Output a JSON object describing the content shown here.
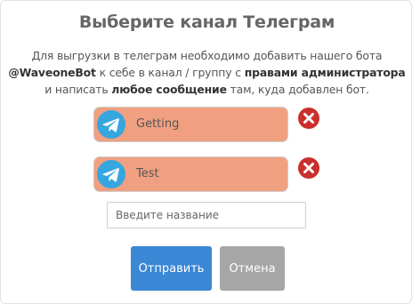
{
  "dialog": {
    "title": "Выберите канал Телеграм",
    "desc": {
      "line1": "Для выгрузки в телеграм необходимо добавить нашего бота",
      "bot": "@WaveoneBot",
      "line2_mid": " к себе в канал / группу с ",
      "rights": "правами администратора",
      "line3_pre": "и написать ",
      "any_message": "любое сообщение",
      "line3_post": " там, куда добавлен бот."
    }
  },
  "channels": [
    {
      "name": "Getting",
      "icon": "telegram-icon",
      "remove_icon": "close-icon"
    },
    {
      "name": "Test",
      "icon": "telegram-icon",
      "remove_icon": "close-icon"
    }
  ],
  "new_channel_input": {
    "value": "",
    "placeholder": "Введите название"
  },
  "buttons": {
    "send": "Отправить",
    "cancel": "Отмена"
  },
  "colors": {
    "channel_bg": "#f0a081",
    "send_button": "#3a87d5",
    "cancel_button": "#a6a6a6",
    "remove_icon": "#c9302c",
    "telegram_icon": "#36a6df"
  }
}
